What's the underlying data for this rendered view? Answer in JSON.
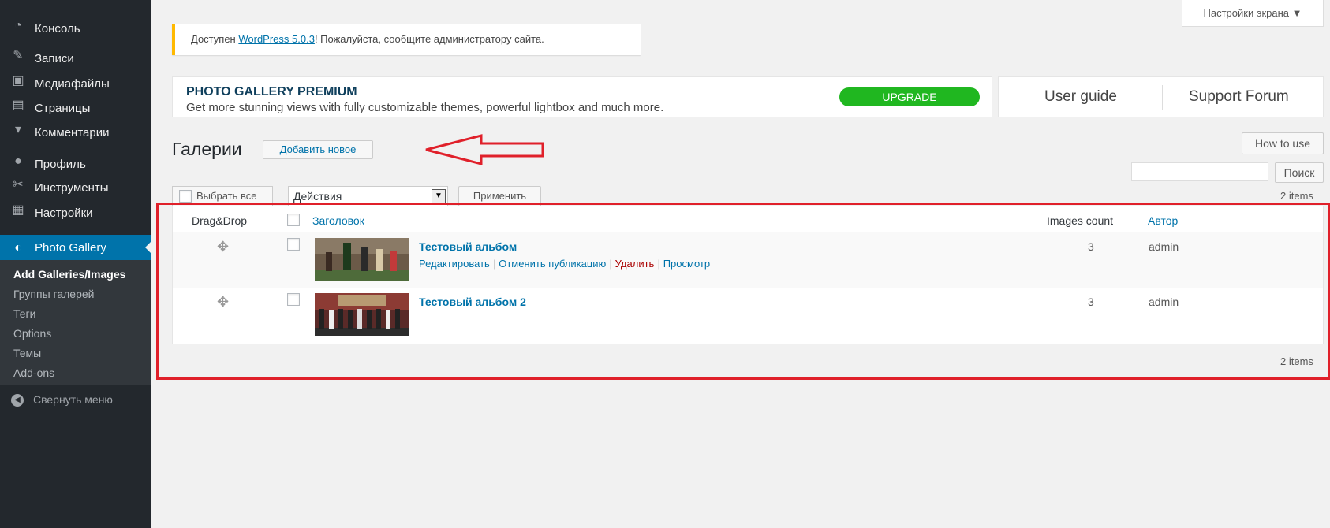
{
  "sidebar": {
    "items": [
      {
        "label": "Консоль",
        "icon": "dashboard-icon"
      },
      {
        "label": "Записи",
        "icon": "pin-icon"
      },
      {
        "label": "Медиафайлы",
        "icon": "media-icon"
      },
      {
        "label": "Страницы",
        "icon": "page-icon"
      },
      {
        "label": "Комментарии",
        "icon": "comment-icon"
      },
      {
        "label": "Профиль",
        "icon": "user-icon"
      },
      {
        "label": "Инструменты",
        "icon": "wrench-icon"
      },
      {
        "label": "Настройки",
        "icon": "settings-icon"
      },
      {
        "label": "Photo Gallery",
        "icon": "photo-gallery-icon"
      }
    ],
    "submenu": [
      "Add Galleries/Images",
      "Группы галерей",
      "Теги",
      "Options",
      "Темы",
      "Add-ons"
    ],
    "collapse_label": "Свернуть меню"
  },
  "screen_options": "Настройки экрана ▼",
  "update_notice": {
    "prefix": "Доступен ",
    "link": "WordPress 5.0.3",
    "suffix": "! Пожалуйста, сообщите администратору сайта."
  },
  "premium": {
    "title": "PHOTO GALLERY PREMIUM",
    "description": "Get more stunning views with fully customizable themes, powerful lightbox and much more.",
    "upgrade_label": "UPGRADE",
    "user_guide": "User guide",
    "support_forum": "Support Forum"
  },
  "page": {
    "title": "Галерии",
    "add_new": "Добавить новое",
    "how_to_use": "How to use",
    "search_button": "Поиск",
    "items_count": "2 items"
  },
  "bulk": {
    "select_all": "Выбрать все",
    "actions": "Действия",
    "apply": "Применить"
  },
  "table": {
    "headers": {
      "drag": "Drag&Drop",
      "title": "Заголовок",
      "images_count": "Images count",
      "author": "Автор"
    },
    "rows": [
      {
        "title": "Тестовый альбом",
        "images": "3",
        "author": "admin",
        "actions": [
          "Редактировать",
          "Отменить публикацию",
          "Удалить",
          "Просмотр"
        ]
      },
      {
        "title": "Тестовый альбом 2",
        "images": "3",
        "author": "admin"
      }
    ]
  },
  "colors": {
    "sidebar_bg": "#23282d",
    "active_menu": "#0073aa",
    "link": "#0073aa",
    "upgrade": "#20b720",
    "highlight": "#e0202a",
    "notice_border": "#ffb900"
  }
}
